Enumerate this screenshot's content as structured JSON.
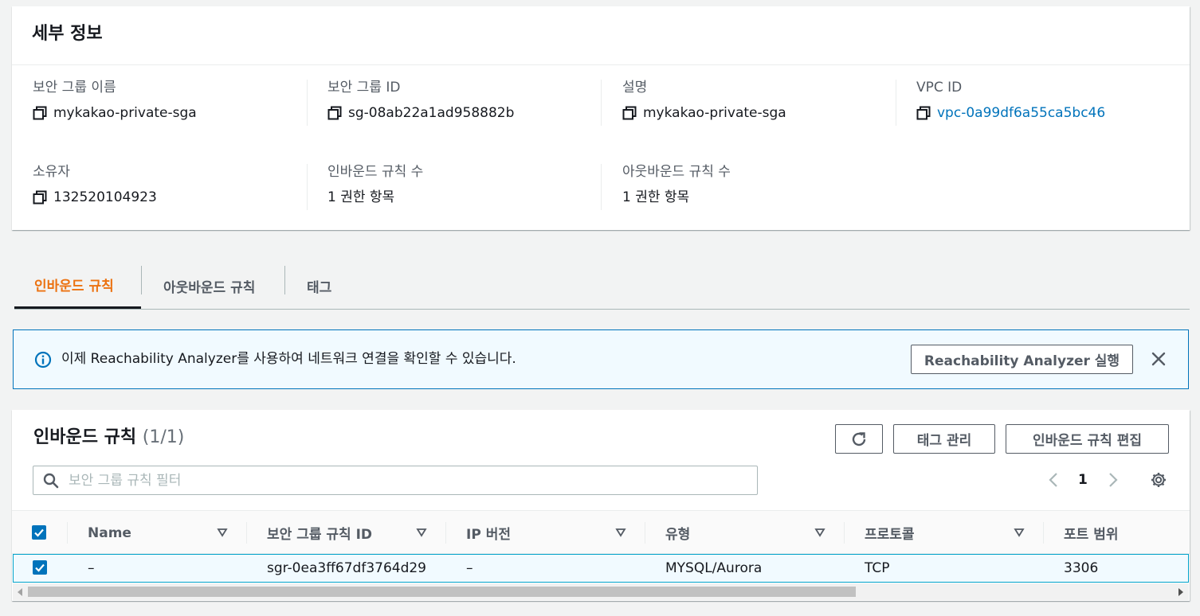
{
  "details": {
    "title": "세부 정보",
    "fields": [
      {
        "label": "보안 그룹 이름",
        "value": "mykakao-private-sga"
      },
      {
        "label": "보안 그룹 ID",
        "value": "sg-08ab22a1ad958882b"
      },
      {
        "label": "설명",
        "value": "mykakao-private-sga"
      },
      {
        "label": "VPC ID",
        "value": "vpc-0a99df6a55ca5bc46"
      },
      {
        "label": "소유자",
        "value": "132520104923"
      },
      {
        "label": "인바운드 규칙 수",
        "value": "1 권한 항목"
      },
      {
        "label": "아웃바운드 규칙 수",
        "value": "1 권한 항목"
      }
    ]
  },
  "tabs": [
    {
      "label": "인바운드 규칙",
      "active": true
    },
    {
      "label": "아웃바운드 규칙",
      "active": false
    },
    {
      "label": "태그",
      "active": false
    }
  ],
  "banner": {
    "message": "이제 Reachability Analyzer를 사용하여 네트워크 연결을 확인할 수 있습니다.",
    "button": "Reachability Analyzer 실행"
  },
  "rules": {
    "title": "인바운드 규칙",
    "count": "(1/1)",
    "manage_tags": "태그 관리",
    "edit_rules": "인바운드 규칙 편집",
    "search_placeholder": "보안 그룹 규칙 필터",
    "page": "1",
    "columns": [
      "Name",
      "보안 그룹 규칙 ID",
      "IP 버전",
      "유형",
      "프로토콜",
      "포트 범위"
    ],
    "rows": [
      {
        "name": "–",
        "rule_id": "sgr-0ea3ff67df3764d29",
        "ip_version": "–",
        "type": "MYSQL/Aurora",
        "protocol": "TCP",
        "port_range": "3306",
        "selected": true
      }
    ]
  },
  "colors": {
    "accent": "#ec7211",
    "link": "#0073bb",
    "selection": "#f1faff"
  }
}
